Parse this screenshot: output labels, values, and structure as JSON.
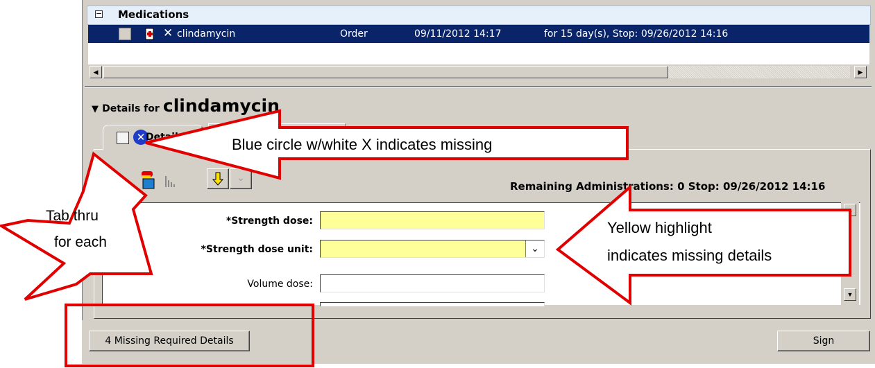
{
  "medications": {
    "section_title": "Medications",
    "row": {
      "name": "clindamycin",
      "type": "Order",
      "start": "09/11/2012 14:17",
      "duration": "for 15 day(s), Stop: 09/26/2012 14:16"
    }
  },
  "details": {
    "prefix": "Details for",
    "drug": "clindamycin",
    "tab_label": "Detail",
    "remaining": "Remaining Administrations: 0  Stop: 09/26/2012 14:16"
  },
  "form": {
    "strength_dose_label": "*Strength dose:",
    "strength_dose_value": "",
    "strength_dose_unit_label": "*Strength dose unit:",
    "strength_dose_unit_value": "",
    "volume_dose_label": "Volume dose:",
    "volume_dose_value": ""
  },
  "footer": {
    "missing_button": "4 Missing Required Details",
    "sign_button": "Sign"
  },
  "annotations": {
    "blue_circle": "Blue circle w/white X indicates missing",
    "tab_thru_line1": "Tab thru",
    "tab_thru_line2": "for  each",
    "yellow_line1": "Yellow highlight",
    "yellow_line2": "indicates missing details"
  },
  "colors": {
    "selection": "#0a246a",
    "missing_highlight": "#ffff99",
    "missing_icon": "#1e3cc8",
    "annotation_red": "#e00000"
  }
}
